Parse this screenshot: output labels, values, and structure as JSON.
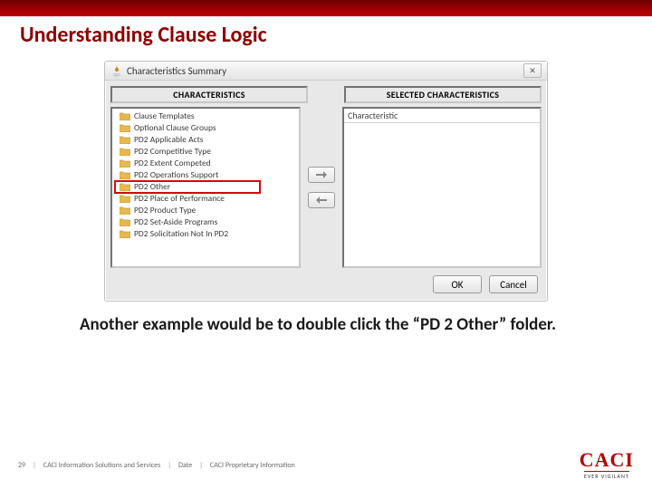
{
  "slide": {
    "title": "Understanding Clause Logic",
    "caption": "Another example would be to double click the “PD 2 Other” folder."
  },
  "dialog": {
    "title": "Characteristics Summary",
    "close_glyph": "✕",
    "headers": {
      "left": "CHARACTERISTICS",
      "right": "SELECTED CHARACTERISTICS"
    },
    "right_col_header": "Characteristic",
    "tree": [
      "Clause Templates",
      "Optional Clause Groups",
      "PD2 Applicable Acts",
      "PD2 Competitive Type",
      "PD2 Extent Competed",
      "PD2 Operations Support",
      "PD2 Other",
      "PD2 Place of Performance",
      "PD2 Product Type",
      "PD2 Set-Aside Programs",
      "PD2 Solicitation Not In PD2"
    ],
    "highlight_index": 6,
    "buttons": {
      "ok": "OK",
      "cancel": "Cancel"
    }
  },
  "footer": {
    "page": "29",
    "org": "CACI Information Solutions and Services",
    "date_label": "Date",
    "notice": "CACI Proprietary Information"
  },
  "logo": {
    "name": "CACI",
    "tagline": "EVER VIGILANT"
  }
}
